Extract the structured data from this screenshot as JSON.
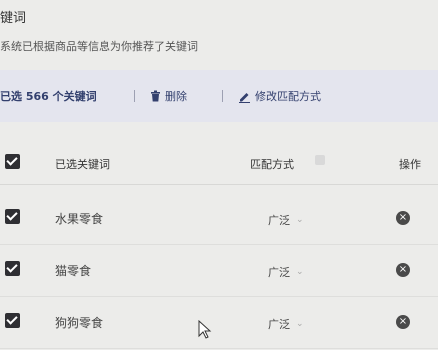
{
  "header": {
    "title": "键词",
    "subtitle": "系统已根据商品等信息为你推荐了关键词"
  },
  "toolbar": {
    "selected_count": "已选 566 个关键词",
    "delete_label": "删除",
    "edit_match_label": "修改匹配方式"
  },
  "table": {
    "columns": [
      "已选关键词",
      "匹配方式",
      "操作"
    ],
    "rows": [
      {
        "keyword": "水果零食",
        "match": "广泛"
      },
      {
        "keyword": "猫零食",
        "match": "广泛"
      },
      {
        "keyword": "狗狗零食",
        "match": "广泛"
      }
    ]
  },
  "icons": {
    "delete": "trash-icon",
    "edit": "pencil-icon",
    "remove": "close-circle-icon",
    "dropdown": "chevron-down-icon"
  },
  "colors": {
    "accent": "#33406e",
    "toolbar_bg": "#e4e5ee",
    "checkbox": "#2f2f33"
  }
}
